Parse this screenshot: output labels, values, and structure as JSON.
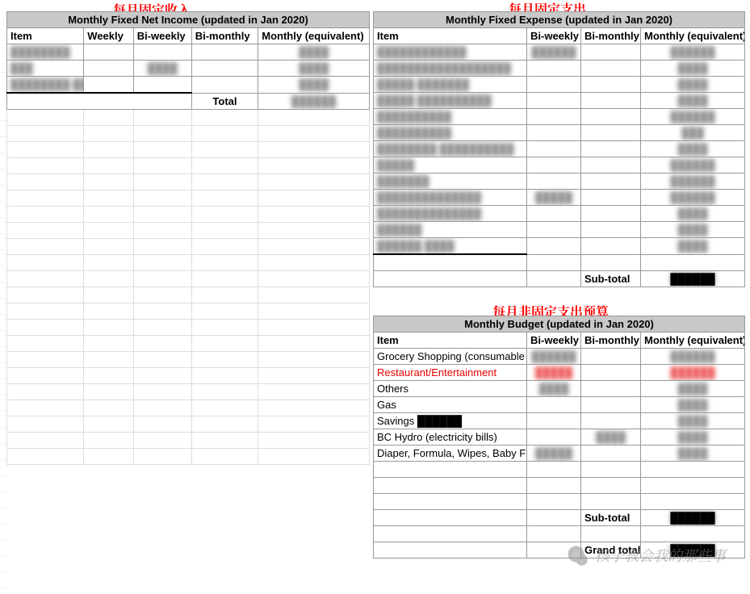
{
  "annotations": {
    "income": "每月固定收入",
    "expense": "每月固定支出",
    "budget": "每月非固定支出预算"
  },
  "income": {
    "title": "Monthly Fixed Net Income (updated in Jan 2020)",
    "headers": {
      "item": "Item",
      "weekly": "Weekly",
      "biweekly": "Bi-weekly",
      "bimonthly": "Bi-monthly",
      "monthly": "Monthly (equivalent)"
    },
    "rows": [
      {
        "item": "████████",
        "weekly": "",
        "biweekly": "",
        "bimonthly": "",
        "monthly": "████"
      },
      {
        "item": "███",
        "weekly": "",
        "biweekly": "████",
        "bimonthly": "",
        "monthly": "████"
      },
      {
        "item": "████████ ████",
        "weekly": "",
        "biweekly": "",
        "bimonthly": "",
        "monthly": "████"
      }
    ],
    "total_label": "Total",
    "total_value": "██████"
  },
  "expense": {
    "title": "Monthly Fixed Expense (updated in Jan 2020)",
    "headers": {
      "item": "Item",
      "biweekly": "Bi-weekly",
      "bimonthly": "Bi-monthly",
      "monthly": "Monthly (equivalent)"
    },
    "rows": [
      {
        "item": "████████████",
        "biweekly": "██████",
        "bimonthly": "",
        "monthly": "██████"
      },
      {
        "item": "██████████████████",
        "biweekly": "",
        "bimonthly": "",
        "monthly": "████"
      },
      {
        "item": "█████ ███████",
        "biweekly": "",
        "bimonthly": "",
        "monthly": "████"
      },
      {
        "item": "█████ ██████████",
        "biweekly": "",
        "bimonthly": "",
        "monthly": "████"
      },
      {
        "item": "██████████",
        "biweekly": "",
        "bimonthly": "",
        "monthly": "██████"
      },
      {
        "item": "██████████",
        "biweekly": "",
        "bimonthly": "",
        "monthly": "███"
      },
      {
        "item": "████████ ██████████",
        "biweekly": "",
        "bimonthly": "",
        "monthly": "████"
      },
      {
        "item": "█████",
        "biweekly": "",
        "bimonthly": "",
        "monthly": "██████"
      },
      {
        "item": "███████",
        "biweekly": "",
        "bimonthly": "",
        "monthly": "██████"
      },
      {
        "item": "██████████████",
        "biweekly": "█████",
        "bimonthly": "",
        "monthly": "██████"
      },
      {
        "item": "██████████████",
        "biweekly": "",
        "bimonthly": "",
        "monthly": "████"
      },
      {
        "item": "██████",
        "biweekly": "",
        "bimonthly": "",
        "monthly": "████"
      },
      {
        "item": "██████ ████",
        "biweekly": "",
        "bimonthly": "",
        "monthly": "████"
      }
    ],
    "subtotal_label": "Sub-total",
    "subtotal_value": "██████"
  },
  "budget": {
    "title": "Monthly Budget (updated in Jan 2020)",
    "headers": {
      "item": "Item",
      "biweekly": "Bi-weekly",
      "bimonthly": "Bi-monthly",
      "monthly": "Monthly (equivalent)"
    },
    "rows": [
      {
        "item": "Grocery Shopping (consumable",
        "biweekly": "██████",
        "bimonthly": "",
        "monthly": "██████",
        "red": false
      },
      {
        "item": "Restaurant/Entertainment",
        "biweekly": "█████",
        "bimonthly": "",
        "monthly": "██████",
        "red": true
      },
      {
        "item": "Others",
        "biweekly": "████",
        "bimonthly": "",
        "monthly": "████",
        "red": false
      },
      {
        "item": "Gas",
        "biweekly": "",
        "bimonthly": "",
        "monthly": "████",
        "red": false
      },
      {
        "item": "Savings ██████",
        "biweekly": "",
        "bimonthly": "",
        "monthly": "████",
        "red": false
      },
      {
        "item": "BC Hydro (electricity bills)",
        "biweekly": "",
        "bimonthly": "████",
        "monthly": "████",
        "red": false
      },
      {
        "item": "Diaper, Formula, Wipes, Baby F",
        "biweekly": "█████",
        "bimonthly": "",
        "monthly": "████",
        "red": false
      }
    ],
    "subtotal_label": "Sub-total",
    "subtotal_value": "██████",
    "grandtotal_label": "Grand total",
    "grandtotal_value": "██████"
  },
  "watermark": "孩子教会我的那些事"
}
